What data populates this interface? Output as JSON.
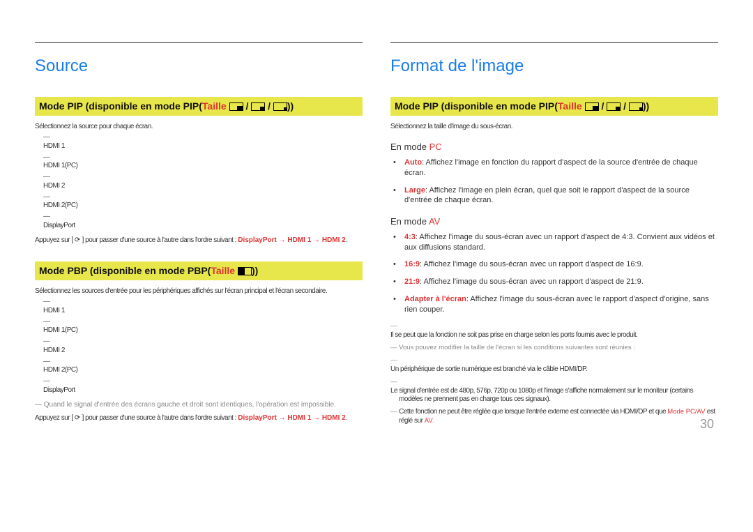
{
  "page_number": "30",
  "left": {
    "title": "Source",
    "pip": {
      "heading_prefix": "Mode PIP (disponible en mode PIP(",
      "heading_taille": "Taille",
      "heading_suffix": "))",
      "intro": "Sélectionnez la source pour chaque écran.",
      "items": [
        "HDMI 1",
        "HDMI 1(PC)",
        "HDMI 2",
        "HDMI 2(PC)",
        "DisplayPort"
      ],
      "seq_prefix": "Appuyez sur [ ",
      "seq_mid": " ] pour passer d'une source à l'autre dans l'ordre suivant : ",
      "seq_chain": "DisplayPort → HDMI 1 → HDMI 2",
      "seq_tail": "."
    },
    "pbp": {
      "heading_prefix": "Mode PBP (disponible en mode PBP(",
      "heading_taille": "Taille",
      "heading_suffix": "))",
      "intro": "Sélectionnez les sources d'entrée pour les périphériques affichés sur l'écran principal et l'écran secondaire.",
      "items": [
        "HDMI 1",
        "HDMI 1(PC)",
        "HDMI 2",
        "HDMI 2(PC)",
        "DisplayPort"
      ],
      "note": "Quand le signal d'entrée des écrans gauche et droit sont identiques, l'opération est impossible.",
      "seq_prefix": "Appuyez sur [ ",
      "seq_mid": " ] pour passer d'une source à l'autre dans l'ordre suivant : ",
      "seq_chain": "DisplayPort → HDMI 1 → HDMI 2",
      "seq_tail": "."
    }
  },
  "right": {
    "title": "Format de l'image",
    "pip": {
      "heading_prefix": "Mode PIP (disponible en mode PIP(",
      "heading_taille": "Taille",
      "heading_suffix": "))",
      "intro": "Sélectionnez la taille d'image du sous-écran."
    },
    "pc": {
      "heading_prefix": "En mode ",
      "heading_em": "PC",
      "bullets": [
        {
          "em": "Auto",
          "text": ": Affichez l'image en fonction du rapport d'aspect de la source d'entrée de chaque écran."
        },
        {
          "em": "Large",
          "text": ": Affichez l'image en plein écran, quel que soit le rapport d'aspect de la source d'entrée de chaque écran."
        }
      ]
    },
    "av": {
      "heading_prefix": "En mode ",
      "heading_em": "AV",
      "bullets": [
        {
          "em": "4:3",
          "text": ": Affichez l'image du sous-écran avec un rapport d'aspect de 4:3. Convient aux vidéos et aux diffusions standard."
        },
        {
          "em": "16:9",
          "text": ": Affichez l'image du sous-écran avec un rapport d'aspect de 16:9."
        },
        {
          "em": "21:9",
          "text": ": Affichez l'image du sous-écran avec un rapport d'aspect de 21:9."
        },
        {
          "em": "Adapter à l'écran",
          "text": ": Affichez l'image du sous-écran avec le rapport d'aspect d'origine, sans rien couper."
        }
      ],
      "footnotes": [
        {
          "text": "Il se peut que la fonction ne soit pas prise en charge selon les ports fournis avec le produit."
        },
        {
          "text": "Vous pouvez modifier la taille de l'écran si les conditions suivantes sont réunies :"
        },
        {
          "text": "Un périphérique de sortie numérique est branché via le câble HDMI/DP."
        },
        {
          "text": "Le signal d'entrée est de 480p, 576p, 720p ou 1080p et l'image s'affiche normalement sur le moniteur (certains modèles ne prennent pas en charge tous ces signaux)."
        },
        {
          "text_pre": "Cette fonction ne peut être réglée que lorsque l'entrée externe est connectée via HDMI/DP et que ",
          "em": "Mode PC/AV",
          "text_mid": " est réglé sur ",
          "em2": "AV",
          "text_tail": "."
        }
      ]
    }
  }
}
